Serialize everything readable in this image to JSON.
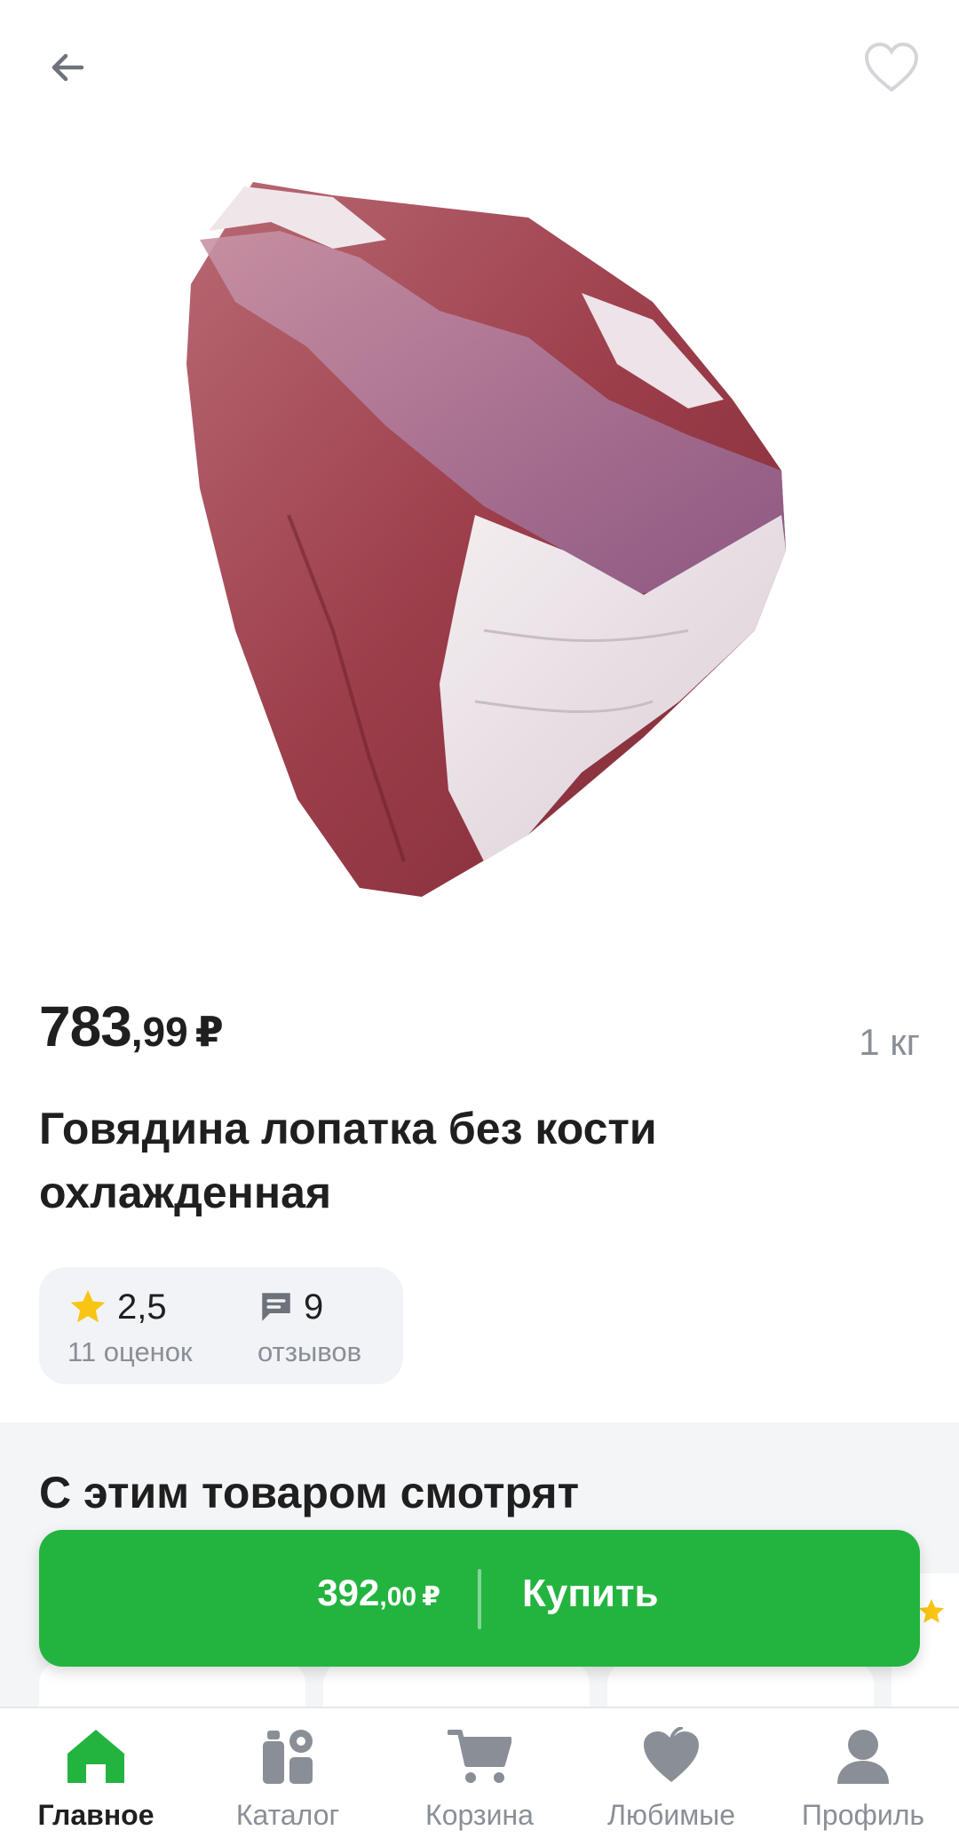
{
  "header": {
    "back_icon": "arrow-left-icon",
    "favorite_icon": "heart-outline-icon"
  },
  "product": {
    "image_description_icon": "beef-shoulder-photo",
    "price_int": "783",
    "price_frac": ",99",
    "price_currency": "₽",
    "unit": "1 кг",
    "title": "Говядина лопатка без кости охлажденная",
    "rating_value": "2,5",
    "rating_count_label": "11 оценок",
    "reviews_value": "9",
    "reviews_label": "отзывов"
  },
  "related": {
    "title": "С этим товаром смотрят"
  },
  "buy_bar": {
    "price_int": "392",
    "price_frac": ",00",
    "price_currency": "₽",
    "label": "Купить"
  },
  "nav": {
    "items": [
      {
        "label": "Главное",
        "icon": "home-icon",
        "active": true
      },
      {
        "label": "Каталог",
        "icon": "catalog-icon",
        "active": false
      },
      {
        "label": "Корзина",
        "icon": "cart-icon",
        "active": false
      },
      {
        "label": "Любимые",
        "icon": "heart-icon",
        "active": false
      },
      {
        "label": "Профиль",
        "icon": "profile-icon",
        "active": false
      }
    ]
  },
  "colors": {
    "accent_green": "#23b440",
    "nav_active": "#23b440",
    "nav_inactive": "#8a8e96",
    "rating_star": "#f9c513"
  }
}
